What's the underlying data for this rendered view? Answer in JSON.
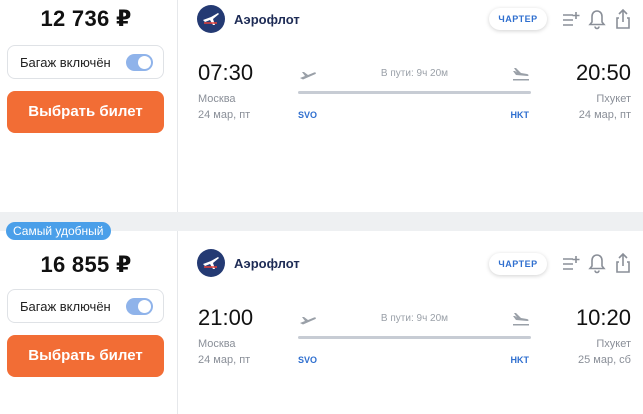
{
  "accent_color": "#f26d35",
  "badge_color": "#4a9fe9",
  "link_color": "#2f6fcf",
  "offers": [
    {
      "price": "12 736 ₽",
      "baggage_label": "Багаж включён",
      "baggage_included": true,
      "buy_label": "Выбрать билет",
      "airline": "Аэрофлот",
      "charter": "ЧАРТЕР",
      "icons": [
        "add-to-list-icon",
        "bell-icon",
        "share-icon"
      ],
      "departure": {
        "time": "07:30",
        "city": "Москва",
        "date": "24 мар, пт",
        "code": "SVO"
      },
      "arrival": {
        "time": "20:50",
        "city": "Пхукет",
        "date": "24 мар, пт",
        "code": "HKT"
      },
      "duration": "В пути: 9ч 20м"
    },
    {
      "badge": "Самый удобный",
      "price": "16 855 ₽",
      "baggage_label": "Багаж включён",
      "baggage_included": true,
      "buy_label": "Выбрать билет",
      "airline": "Аэрофлот",
      "charter": "ЧАРТЕР",
      "icons": [
        "add-to-list-icon",
        "bell-icon",
        "share-icon"
      ],
      "departure": {
        "time": "21:00",
        "city": "Москва",
        "date": "24 мар, пт",
        "code": "SVO"
      },
      "arrival": {
        "time": "10:20",
        "city": "Пхукет",
        "date": "25 мар, сб",
        "code": "HKT"
      },
      "duration": "В пути: 9ч 20м"
    }
  ]
}
